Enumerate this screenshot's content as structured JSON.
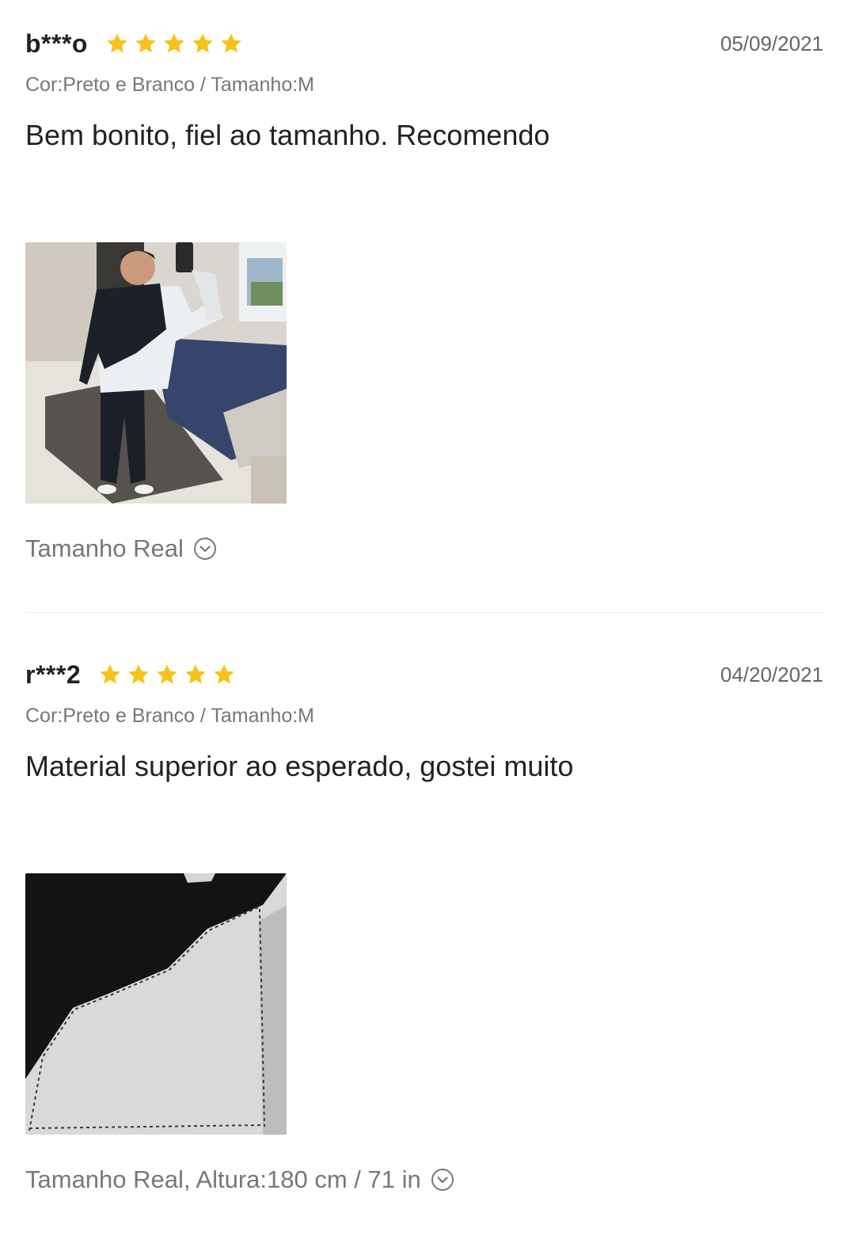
{
  "reviews": [
    {
      "user": "b***o",
      "rating": 5,
      "date": "05/09/2021",
      "meta": "Cor:Preto e Branco / Tamanho:M",
      "text": "Bem bonito, fiel ao tamanho. Recomendo",
      "fit": "Tamanho Real"
    },
    {
      "user": "r***2",
      "rating": 5,
      "date": "04/20/2021",
      "meta": "Cor:Preto e Branco / Tamanho:M",
      "text": "Material superior ao esperado, gostei muito",
      "fit": "Tamanho Real, Altura:180 cm / 71 in"
    }
  ],
  "colors": {
    "star": "#f7c21a",
    "divider": "#ececec"
  },
  "icons": {
    "rating": "star-icon",
    "expand": "chevron-down-circle-icon"
  }
}
